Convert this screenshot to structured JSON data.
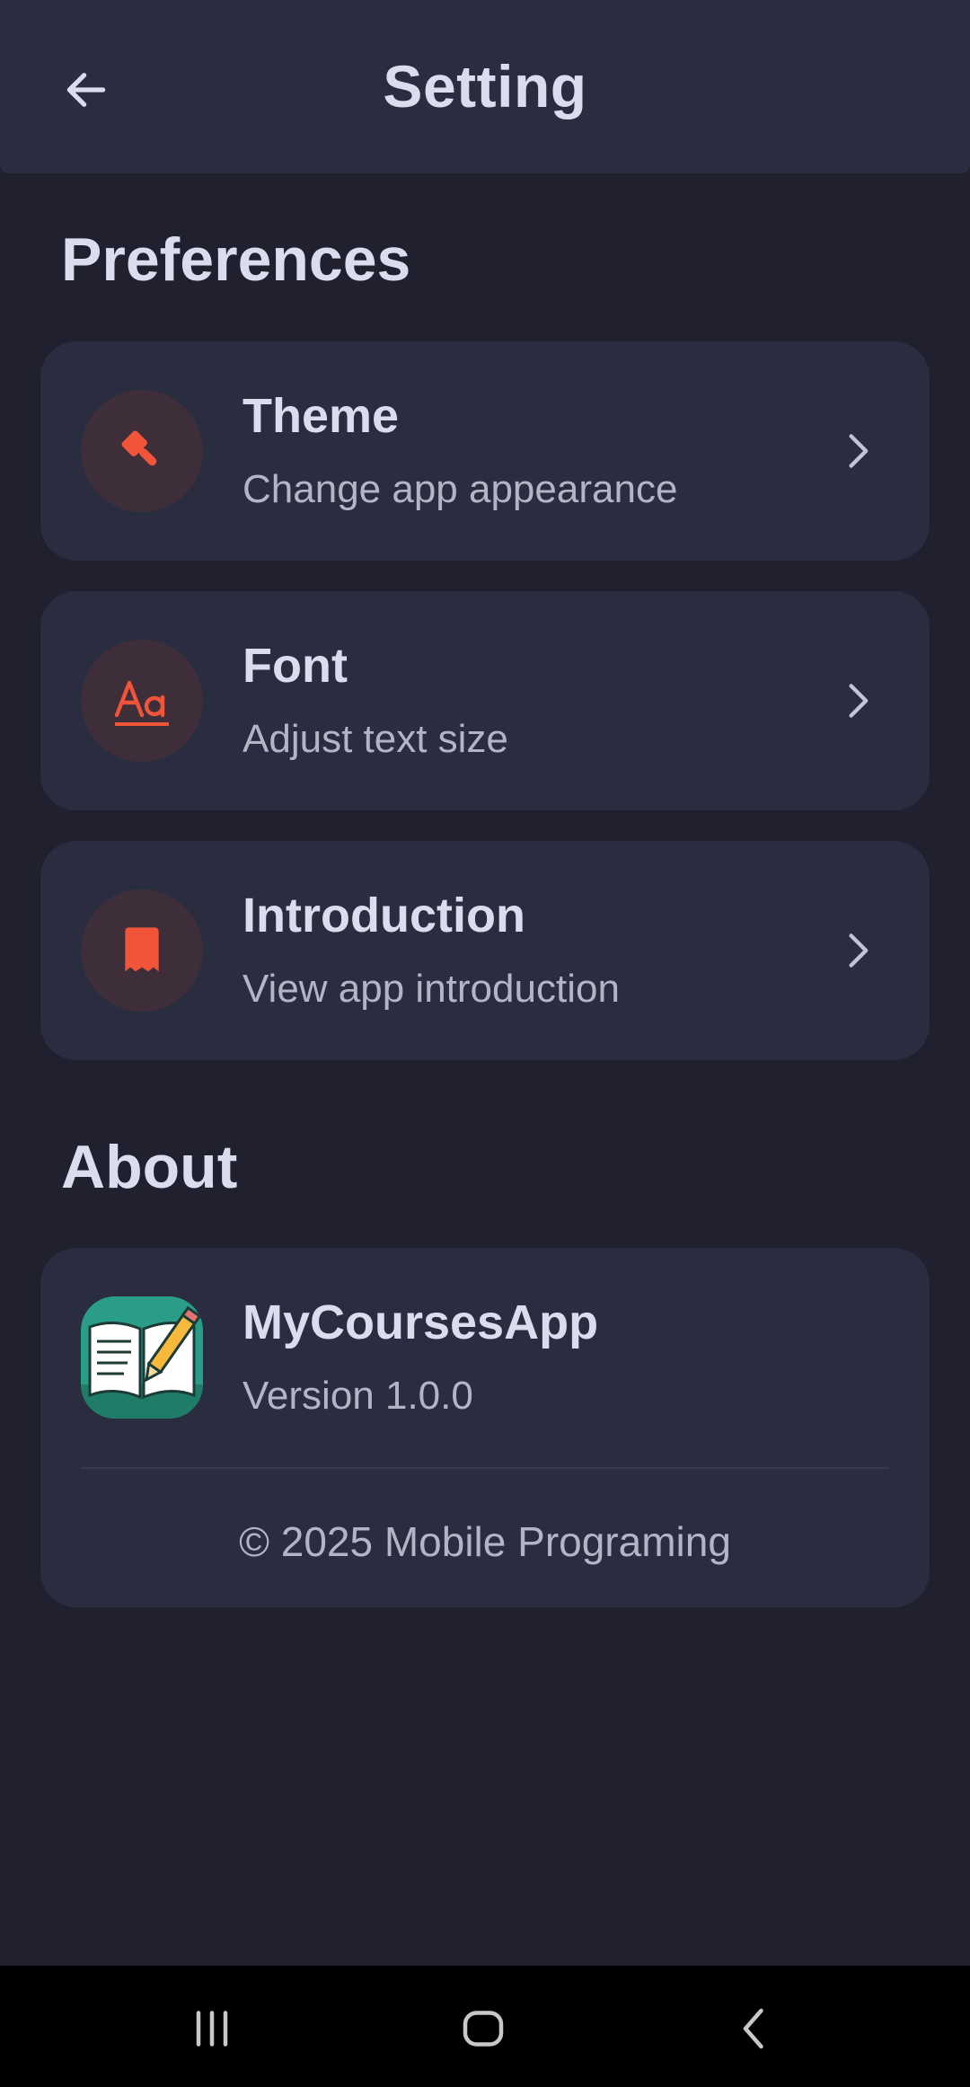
{
  "header": {
    "title": "Setting",
    "back_icon": "arrow-left-icon"
  },
  "preferences": {
    "title": "Preferences",
    "items": [
      {
        "title": "Theme",
        "subtitle": "Change app appearance",
        "icon": "paint-brush-icon"
      },
      {
        "title": "Font",
        "subtitle": "Adjust text size",
        "icon": "font-size-icon"
      },
      {
        "title": "Introduction",
        "subtitle": "View app introduction",
        "icon": "receipt-icon"
      }
    ]
  },
  "about": {
    "title": "About",
    "app_name": "MyCoursesApp",
    "version": "Version 1.0.0",
    "copyright": "© 2025 Mobile Programing",
    "logo_icon": "book-pencil-logo"
  },
  "nav": {
    "recents_icon": "recents-icon",
    "home_icon": "home-icon",
    "back_icon": "back-icon"
  },
  "colors": {
    "background": "#20202f",
    "card": "#2a2c40",
    "accent": "#f0553a",
    "icon_bg": "#3d2e3a",
    "text_primary": "#dcdcef",
    "text_secondary": "#b4b4c6"
  }
}
